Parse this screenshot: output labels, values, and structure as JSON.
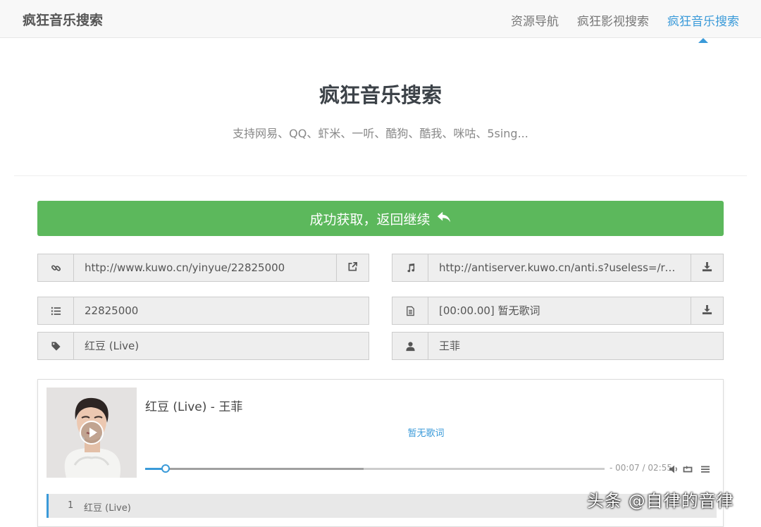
{
  "navbar": {
    "brand": "疯狂音乐搜索",
    "links": [
      {
        "label": "资源导航"
      },
      {
        "label": "疯狂影视搜索"
      },
      {
        "label": "疯狂音乐搜索"
      }
    ]
  },
  "header": {
    "title": "疯狂音乐搜索",
    "subtitle": "支持网易、QQ、虾米、一听、酷狗、酷我、咪咕、5sing..."
  },
  "success_button": {
    "label": "成功获取，返回继续"
  },
  "fields": {
    "link": {
      "value": "http://www.kuwo.cn/yinyue/22825000"
    },
    "audio_url": {
      "value": "http://antiserver.kuwo.cn/anti.s?useless=/resource/"
    },
    "song_id": {
      "value": "22825000"
    },
    "lyric": {
      "value": "[00:00.00] 暂无歌词"
    },
    "song_name": {
      "value": "红豆 (Live)"
    },
    "artist": {
      "value": "王菲"
    }
  },
  "player": {
    "title": "红豆 (Live) - 王菲",
    "lyric_line": "暂无歌词",
    "time": "- 00:07 / 02:55",
    "played_fraction": 0.045,
    "loaded_fraction": 0.475,
    "playlist": [
      {
        "index": "1",
        "name": "红豆 (Live)"
      }
    ]
  },
  "watermark": "头条 @自律的音律",
  "colors": {
    "accent": "#3a9ad9",
    "success": "#5cb85c"
  }
}
